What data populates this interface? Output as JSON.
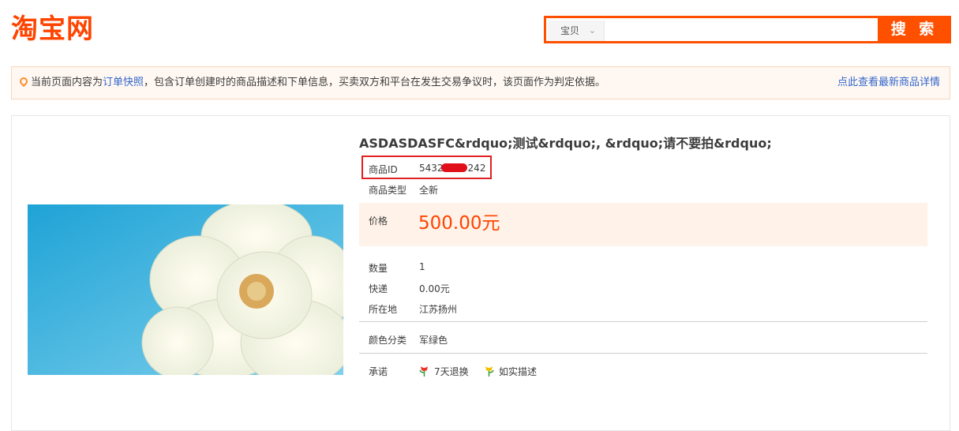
{
  "header": {
    "logo_text": "淘宝网",
    "search": {
      "category": "宝贝",
      "placeholder": "",
      "button_label": "搜 索"
    }
  },
  "notice": {
    "prefix": "当前页面内容为",
    "link_snapshot": "订单快照",
    "suffix": "，包含订单创建时的商品描述和下单信息，买卖双方和平台在发生交易争议时，该页面作为判定依据。",
    "right_link": "点此查看最新商品详情"
  },
  "item": {
    "title": "ASDASDASFC&rdquo;测试&rdquo;, &rdquo;请不要拍&rdquo;",
    "fields": {
      "id_label": "商品ID",
      "id_value_start": "5432",
      "id_value_end": "242",
      "type_label": "商品类型",
      "type_value": "全新",
      "price_label": "价格",
      "price_value": "500.00元",
      "qty_label": "数量",
      "qty_value": "1",
      "shipping_label": "快递",
      "shipping_value": "0.00元",
      "location_label": "所在地",
      "location_value": "江苏扬州",
      "color_label": "颜色分类",
      "color_value": "军绿色",
      "promise_label": "承诺",
      "promise_1": "7天退换",
      "promise_2": "如实描述"
    }
  },
  "colors": {
    "brand": "#ff5000",
    "price": "#ff4400",
    "link": "#3366cc",
    "redact_box": "#e02020"
  }
}
